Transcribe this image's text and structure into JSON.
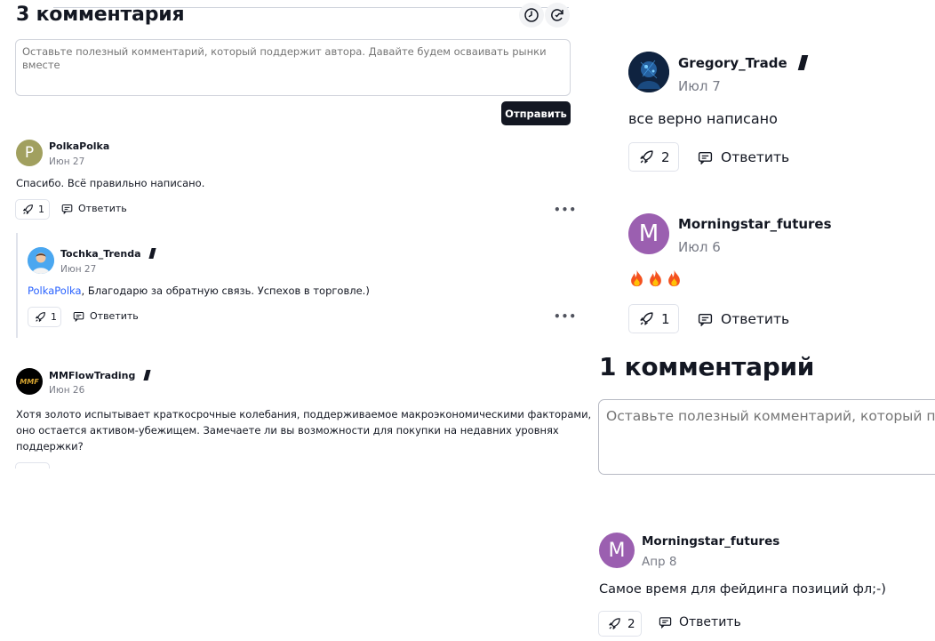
{
  "left": {
    "title": "3 комментария",
    "input_placeholder": "Оставьте полезный комментарий, который поддержит автора. Давайте будем осваивать рынки вместе",
    "send_label": "Отправить",
    "comments": [
      {
        "user": "PolkaPolka",
        "avatar_letter": "P",
        "date": "Июн 27",
        "text": "Спасибо. Всё правильно написано.",
        "boosts": "1",
        "reply_label": "Ответить"
      },
      {
        "user": "Tochka_Trenda",
        "date": "Июн 27",
        "mention": "PolkaPolka",
        "text": ", Благодарю за обратную связь. Успехов в торговле.)",
        "boosts": "1",
        "reply_label": "Ответить"
      },
      {
        "user": "MMFlowTrading",
        "avatar_text": "MMF",
        "date": "Июн 26",
        "text_lines": [
          "Хотя золото испытывает краткосрочные колебания, поддерживаемое макроэкономическими факторами,",
          "оно остается активом-убежищем. Замечаете ли вы возможности для покупки на недавних уровнях",
          "поддержки?"
        ]
      }
    ],
    "more_label": "•••"
  },
  "right": {
    "comments": [
      {
        "user": "Gregory_Trade",
        "date": "Июл 7",
        "text": "все верно написано",
        "boosts": "2",
        "reply_label": "Ответить"
      },
      {
        "user": "Morningstar_futures",
        "avatar_letter": "M",
        "date": "Июл 6",
        "boosts": "1",
        "reply_label": "Ответить"
      }
    ],
    "title": "1 комментарий",
    "input_placeholder": "Оставьте полезный комментарий, который подде",
    "comment2": {
      "user": "Morningstar_futures",
      "avatar_letter": "M",
      "date": "Апр 8",
      "text": "Самое время для фейдинга позиций фл;-)",
      "boosts": "2",
      "reply_label": "Ответить"
    }
  },
  "colors": {
    "accent": "#2962ff",
    "dark": "#131722",
    "muted": "#787b86",
    "polka_avatar": "#a1a05f",
    "morning_avatar": "#9b5fb0"
  }
}
